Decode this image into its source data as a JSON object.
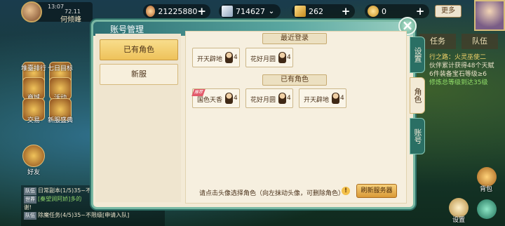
{
  "player": {
    "time": "13:07",
    "id": "72.11",
    "name": "何倾峰"
  },
  "resources": [
    {
      "icon": "copper-coin-icon",
      "value": "21225880"
    },
    {
      "icon": "silver-ingot-icon",
      "value": "714627"
    },
    {
      "icon": "gold-scroll-icon",
      "value": "262"
    },
    {
      "icon": "yuanbao-icon",
      "value": "0"
    }
  ],
  "top": {
    "more_label": "更多"
  },
  "left_menu": [
    {
      "label": "堆臺排行"
    },
    {
      "label": "七日目标"
    },
    {
      "label": "商城"
    },
    {
      "label": "活动"
    },
    {
      "label": "交易"
    },
    {
      "label": "新服盛典"
    },
    {
      "label": "好友"
    }
  ],
  "right_tabs": {
    "task": "任务",
    "team": "队伍"
  },
  "quest": {
    "line1": "行之路：火灵巫使二",
    "line2": "伙伴累计获得48个天赋",
    "line3": "6件装备宝石等级≥6",
    "line4": "修炼总等级到达35级"
  },
  "chat": {
    "lines": [
      {
        "tag": "队伍",
        "text": "日常副本(1/5)35~不限"
      },
      {
        "tag": "世界",
        "text": "[秦望涧阿娇]多的"
      },
      {
        "tag": "",
        "text": "谢!"
      },
      {
        "tag": "队伍",
        "text": "除魔任务(4/5)35~不限级[申请入队]"
      }
    ]
  },
  "bottom_right": {
    "bag_label": "背包",
    "settings_label": "设置"
  },
  "dialog": {
    "title": "账号管理",
    "categories": [
      {
        "label": "已有角色",
        "active": true
      },
      {
        "label": "新服",
        "active": false
      }
    ],
    "recent_login_header": "最近登录",
    "existing_header": "已有角色",
    "recent": [
      {
        "server": "开天辟地",
        "count": "4"
      },
      {
        "server": "花好月圆",
        "count": "4"
      }
    ],
    "existing": [
      {
        "server": "国色天香",
        "count": "4",
        "badge": "推荐"
      },
      {
        "server": "花好月圆",
        "count": "4"
      },
      {
        "server": "开天辟地",
        "count": "4"
      }
    ],
    "hint": "请点击头像选择角色（向左抹动头像，可删除角色）",
    "refresh_label": "刷新服务器",
    "side_tabs": [
      {
        "label": "设置"
      },
      {
        "label": "角色"
      },
      {
        "label": "账号"
      }
    ]
  },
  "colors": {
    "accent": "#2a6f64",
    "gold": "#eec25a",
    "panel": "#f3ead6"
  }
}
